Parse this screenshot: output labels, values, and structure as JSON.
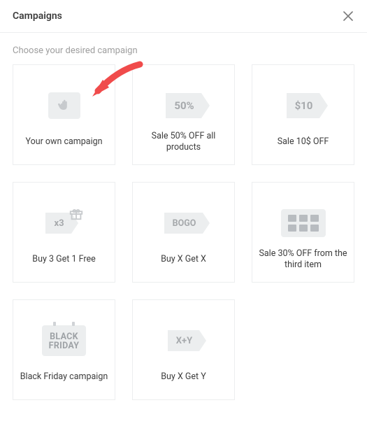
{
  "header": {
    "title": "Campaigns"
  },
  "subtitle": "Choose your desired campaign",
  "campaigns": [
    {
      "label": "Your own campaign",
      "badge": ""
    },
    {
      "label": "Sale 50% OFF all products",
      "badge": "50%"
    },
    {
      "label": "Sale 10$ OFF",
      "badge": "$10"
    },
    {
      "label": "Buy 3 Get 1 Free",
      "badge": "x3"
    },
    {
      "label": "Buy X Get X",
      "badge": "BOGO"
    },
    {
      "label": "Sale 30% OFF from the third item",
      "badge": ""
    },
    {
      "label": "Black Friday campaign",
      "badge_top": "BLACK",
      "badge_bottom": "FRIDAY"
    },
    {
      "label": "Buy X Get Y",
      "badge": "X+Y"
    }
  ],
  "annotation": {
    "arrow_points_to": "own-campaign-card"
  }
}
